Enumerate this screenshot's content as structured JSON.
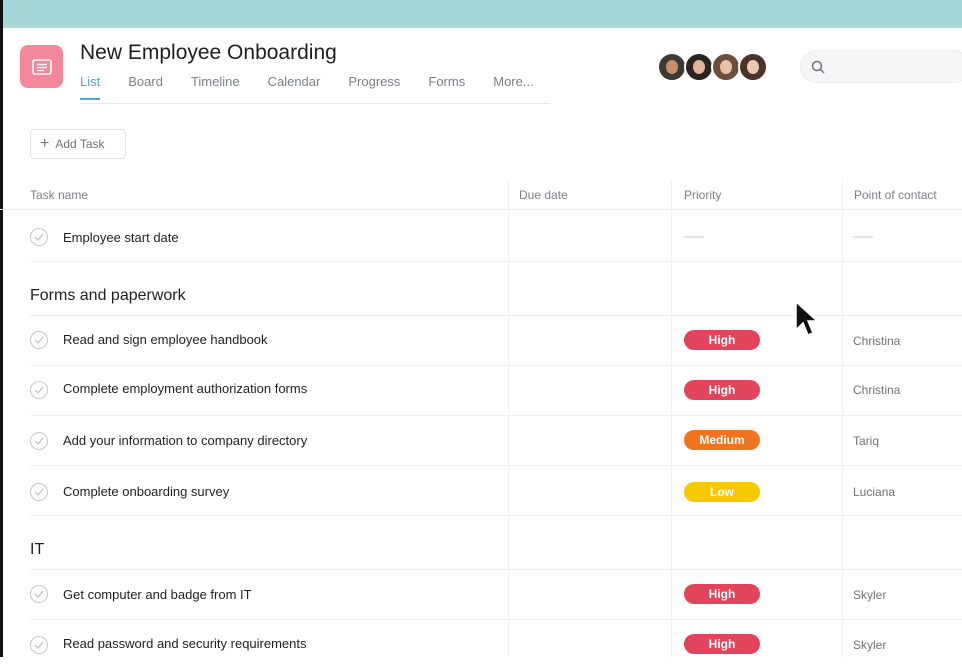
{
  "project": {
    "title": "New Employee Onboarding",
    "icon": "list-icon",
    "icon_color": "#f4879b"
  },
  "tabs": [
    {
      "label": "List",
      "active": true
    },
    {
      "label": "Board",
      "active": false
    },
    {
      "label": "Timeline",
      "active": false
    },
    {
      "label": "Calendar",
      "active": false
    },
    {
      "label": "Progress",
      "active": false
    },
    {
      "label": "Forms",
      "active": false
    },
    {
      "label": "More...",
      "active": false
    }
  ],
  "members": [
    "avatar",
    "avatar",
    "avatar",
    "avatar"
  ],
  "search": {
    "placeholder": "",
    "icon": "search-icon"
  },
  "toolbar": {
    "add_task_label": "Add Task"
  },
  "columns": {
    "task": "Task name",
    "due": "Due date",
    "priority": "Priority",
    "contact": "Point of contact"
  },
  "top_task": {
    "name": "Employee start date"
  },
  "sections": [
    {
      "title": "Forms and paperwork",
      "tasks": [
        {
          "name": "Read and sign employee handbook",
          "priority": "High",
          "contact": "Christina"
        },
        {
          "name": "Complete employment authorization forms",
          "priority": "High",
          "contact": "Christina"
        },
        {
          "name": "Add your information to company directory",
          "priority": "Medium",
          "contact": "Tariq"
        },
        {
          "name": "Complete onboarding survey",
          "priority": "Low",
          "contact": "Luciana"
        }
      ]
    },
    {
      "title": "IT",
      "tasks": [
        {
          "name": "Get computer and badge from IT",
          "priority": "High",
          "contact": "Skyler"
        },
        {
          "name": "Read password and security requirements",
          "priority": "High",
          "contact": "Skyler"
        }
      ]
    }
  ],
  "colors": {
    "accent": "#4ba6d6",
    "high": "#e2445c",
    "medium": "#f0741f",
    "low": "#f6c902",
    "banner": "#a8d7d7"
  }
}
